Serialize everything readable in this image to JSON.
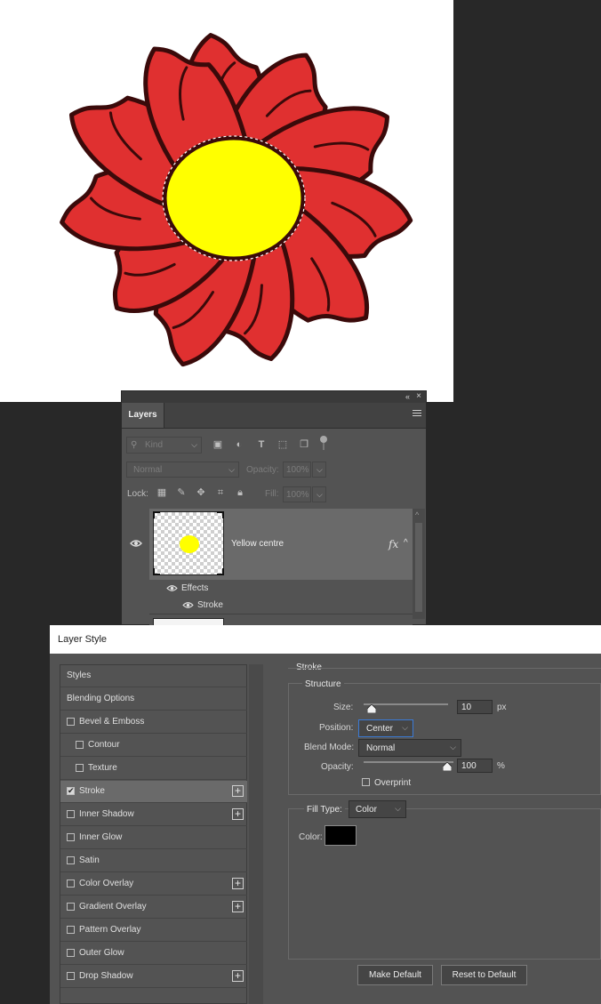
{
  "canvas": {
    "petal_color": "#e03030",
    "outline_color": "#3a0a0a",
    "center_color": "#ffff00"
  },
  "layers_panel": {
    "tab_label": "Layers",
    "filter_kind_placeholder": "Kind",
    "blend_mode": "Normal",
    "opacity_label": "Opacity:",
    "opacity_value": "100%",
    "lock_label": "Lock:",
    "fill_label": "Fill:",
    "fill_value": "100%",
    "layer": {
      "name": "Yellow centre",
      "fx_label": "fx",
      "effects_label": "Effects",
      "effect_item": "Stroke"
    }
  },
  "layer_style": {
    "title": "Layer Style",
    "styles": [
      {
        "label": "Styles",
        "checkbox": false,
        "checked": false,
        "plus": false,
        "indent": 0
      },
      {
        "label": "Blending Options",
        "checkbox": false,
        "checked": false,
        "plus": false,
        "indent": 0
      },
      {
        "label": "Bevel & Emboss",
        "checkbox": true,
        "checked": false,
        "plus": false,
        "indent": 0
      },
      {
        "label": "Contour",
        "checkbox": true,
        "checked": false,
        "plus": false,
        "indent": 1
      },
      {
        "label": "Texture",
        "checkbox": true,
        "checked": false,
        "plus": false,
        "indent": 1
      },
      {
        "label": "Stroke",
        "checkbox": true,
        "checked": true,
        "plus": true,
        "indent": 0,
        "selected": true
      },
      {
        "label": "Inner Shadow",
        "checkbox": true,
        "checked": false,
        "plus": true,
        "indent": 0
      },
      {
        "label": "Inner Glow",
        "checkbox": true,
        "checked": false,
        "plus": false,
        "indent": 0
      },
      {
        "label": "Satin",
        "checkbox": true,
        "checked": false,
        "plus": false,
        "indent": 0
      },
      {
        "label": "Color Overlay",
        "checkbox": true,
        "checked": false,
        "plus": true,
        "indent": 0
      },
      {
        "label": "Gradient Overlay",
        "checkbox": true,
        "checked": false,
        "plus": true,
        "indent": 0
      },
      {
        "label": "Pattern Overlay",
        "checkbox": true,
        "checked": false,
        "plus": false,
        "indent": 0
      },
      {
        "label": "Outer Glow",
        "checkbox": true,
        "checked": false,
        "plus": false,
        "indent": 0
      },
      {
        "label": "Drop Shadow",
        "checkbox": true,
        "checked": false,
        "plus": true,
        "indent": 0
      }
    ],
    "stroke": {
      "section_title": "Stroke",
      "structure_title": "Structure",
      "size_label": "Size:",
      "size_value": "10",
      "size_unit": "px",
      "position_label": "Position:",
      "position_value": "Center",
      "blend_mode_label": "Blend Mode:",
      "blend_mode_value": "Normal",
      "opacity_label": "Opacity:",
      "opacity_value": "100",
      "opacity_unit": "%",
      "opacity_level": 1.0,
      "overprint_label": "Overprint",
      "overprint_checked": false,
      "fill_type_label": "Fill Type:",
      "fill_type_value": "Color",
      "color_label": "Color:",
      "color_value": "#000000"
    },
    "buttons": {
      "make_default": "Make Default",
      "reset_default": "Reset to Default"
    }
  }
}
